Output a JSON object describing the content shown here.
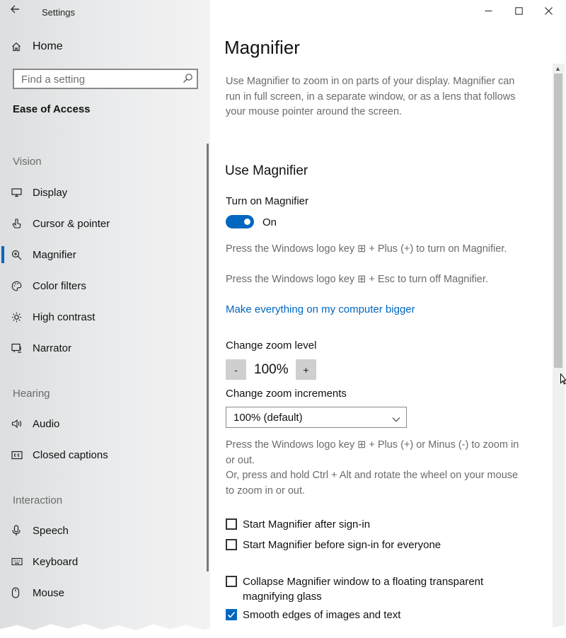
{
  "window": {
    "app_title": "Settings"
  },
  "sidebar": {
    "home_label": "Home",
    "search_placeholder": "Find a setting",
    "section": "Ease of Access",
    "groups": {
      "vision": "Vision",
      "hearing": "Hearing",
      "interaction": "Interaction"
    },
    "items": [
      {
        "label": "Display",
        "icon": "display-icon"
      },
      {
        "label": "Cursor & pointer",
        "icon": "cursor-pointer-icon"
      },
      {
        "label": "Magnifier",
        "icon": "magnifier-icon",
        "selected": true
      },
      {
        "label": "Color filters",
        "icon": "color-filters-icon"
      },
      {
        "label": "High contrast",
        "icon": "high-contrast-icon"
      },
      {
        "label": "Narrator",
        "icon": "narrator-icon"
      },
      {
        "label": "Audio",
        "icon": "audio-icon"
      },
      {
        "label": "Closed captions",
        "icon": "closed-captions-icon"
      },
      {
        "label": "Speech",
        "icon": "speech-icon"
      },
      {
        "label": "Keyboard",
        "icon": "keyboard-icon"
      },
      {
        "label": "Mouse",
        "icon": "mouse-icon"
      }
    ]
  },
  "main": {
    "title": "Magnifier",
    "description": "Use Magnifier to zoom in on parts of your display. Magnifier can run in full screen, in a separate window, or as a lens that follows your mouse pointer around the screen.",
    "use_heading": "Use Magnifier",
    "turn_on_label": "Turn on Magnifier",
    "toggle_state": "On",
    "shortcut_on": "Press the Windows logo key ⊞ + Plus (+) to turn on Magnifier.",
    "shortcut_off": "Press the Windows logo key ⊞ + Esc to turn off Magnifier.",
    "link_bigger": "Make everything on my computer bigger",
    "zoom_level_label": "Change zoom level",
    "zoom_minus": "-",
    "zoom_value": "100%",
    "zoom_plus": "+",
    "zoom_increments_label": "Change zoom increments",
    "zoom_increments_value": "100% (default)",
    "zoom_hint_1": "Press the Windows logo key ⊞ + Plus (+) or Minus (-) to zoom in or out.",
    "zoom_hint_2": "Or, press and hold Ctrl + Alt and rotate the wheel on your mouse to zoom in or out.",
    "checkboxes": [
      {
        "label": "Start Magnifier after sign-in",
        "checked": false
      },
      {
        "label": "Start Magnifier before sign-in for everyone",
        "checked": false
      },
      {
        "label": "Collapse Magnifier window to a floating transparent magnifying glass",
        "checked": false
      },
      {
        "label": "Smooth edges of images and text",
        "checked": true
      }
    ]
  },
  "colors": {
    "accent": "#0067c0"
  }
}
